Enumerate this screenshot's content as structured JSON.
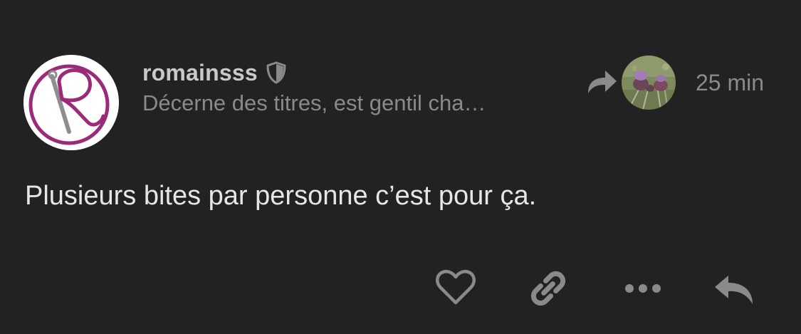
{
  "post": {
    "username": "romainsss",
    "user_title": "Décerne des titres, est gentil cha…",
    "time": "25 min",
    "content": "Plusieurs bites par personne c’est pour ça."
  },
  "icons": {
    "badge": "shield-icon",
    "reply_to": "share-arrow-icon",
    "like": "heart-icon",
    "link": "link-icon",
    "more": "ellipsis-icon",
    "reply": "reply-icon"
  },
  "colors": {
    "background": "#222222",
    "username": "#c9c9c9",
    "muted": "#8a8a8a",
    "content": "#e6e6e6",
    "avatar_accent": "#9b2a78"
  }
}
